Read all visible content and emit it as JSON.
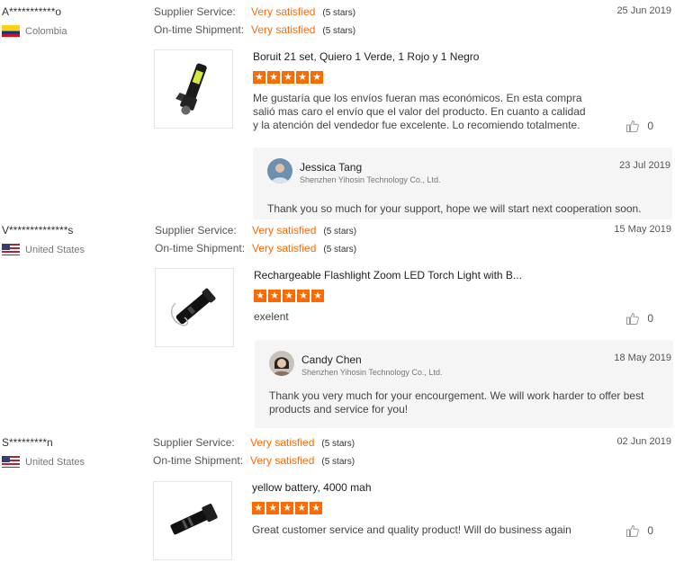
{
  "reviews": [
    {
      "buyer_name": "A***********o",
      "country": "Colombia",
      "flag": "colombia-flag",
      "supplier_service_label": "Supplier Service:",
      "supplier_service_value": "Very satisfied",
      "supplier_service_stars": "(5 stars)",
      "shipment_label": "On-time Shipment:",
      "shipment_value": "Very satisfied",
      "shipment_stars": "(5 stars)",
      "date": "25 Jun 2019",
      "product_title": "Boruit 21 set, Quiero 1 Verde, 1 Rojo y 1 Negro",
      "rating": 5,
      "comment": "Me gustaría que los envíos fueran mas económicos. En esta compra salió mas caro el envío que el valor del producto. En cuanto a calidad y la atención del vendedor fue excelente. Lo recomiendo totalmente.",
      "likes": "0",
      "reply": {
        "name": "Jessica Tang",
        "company": "Shenzhen Yihosin Technology Co., Ltd.",
        "date": "23 Jul 2019",
        "text": "Thank you so much for your support, hope we will start next cooperation soon."
      }
    },
    {
      "buyer_name": "V**************s",
      "country": "United States",
      "flag": "us-flag",
      "supplier_service_label": "Supplier Service:",
      "supplier_service_value": "Very satisfied",
      "supplier_service_stars": "(5 stars)",
      "shipment_label": "On-time Shipment:",
      "shipment_value": "Very satisfied",
      "shipment_stars": "(5 stars)",
      "date": "15 May 2019",
      "product_title": "Rechargeable Flashlight Zoom LED Torch Light with B...",
      "rating": 5,
      "comment": "exelent",
      "likes": "0",
      "reply": {
        "name": "Candy Chen",
        "company": "Shenzhen Yihosin Technology Co., Ltd.",
        "date": "18 May 2019",
        "text": "Thank you very much for your encourgement. We will work harder to offer best products and service for you!"
      }
    },
    {
      "buyer_name": "S*********n",
      "country": "United States",
      "flag": "us-flag",
      "supplier_service_label": "Supplier Service:",
      "supplier_service_value": "Very satisfied",
      "supplier_service_stars": "(5 stars)",
      "shipment_label": "On-time Shipment:",
      "shipment_value": "Very satisfied",
      "shipment_stars": "(5 stars)",
      "date": "02 Jun 2019",
      "product_title": "yellow battery, 4000 mah",
      "rating": 5,
      "comment": "Great customer service and quality product! Will do business again",
      "likes": "0"
    }
  ],
  "colors": {
    "accent": "#ff6a00",
    "reply_bg": "#f5f5f5"
  },
  "icons": {
    "like": "thumbs-up-icon",
    "star": "star-icon"
  }
}
